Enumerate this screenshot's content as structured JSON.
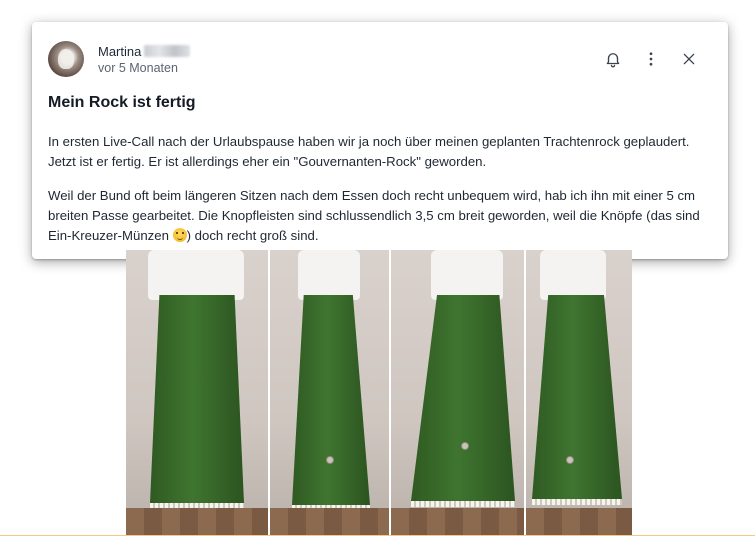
{
  "post": {
    "author_name": "Martina",
    "timestamp": "vor 5 Monaten",
    "title": "Mein Rock ist fertig",
    "paragraph_1": "In ersten Live-Call nach der Urlaubspause haben wir ja noch über meinen geplanten Trachtenrock geplaudert. Jetzt ist er fertig. Er ist allerdings eher ein \"Gouvernanten-Rock\" geworden.",
    "paragraph_2_before_emoji": "Weil der Bund oft beim längeren Sitzen nach dem Essen doch recht unbequem wird,  hab ich ihn mit einer 5 cm breiten Passe gearbeitet. Die Knopfleisten sind schlussendlich 3,5 cm breit geworden, weil die Knöpfe (das sind Ein-Kreuzer-Münzen ",
    "paragraph_2_after_emoji": ") doch recht groß sind."
  },
  "icons": {
    "notification": "bell-icon",
    "more": "more-vertical-icon",
    "close": "close-icon",
    "emoji": "smiling-face-emoji"
  },
  "colors": {
    "text_primary": "#141b24",
    "text_secondary": "#5b6472",
    "skirt_green": "#3f7530",
    "wall": "#d9d1cc"
  },
  "photos": [
    {
      "view": "front"
    },
    {
      "view": "side"
    },
    {
      "view": "back-angle"
    },
    {
      "view": "side-back"
    }
  ]
}
